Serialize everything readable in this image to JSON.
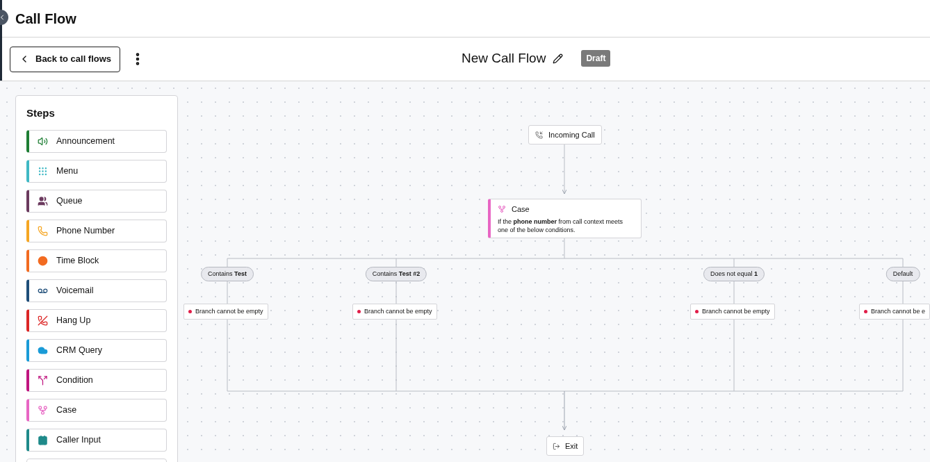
{
  "header": {
    "title": "Call Flow"
  },
  "toolbar": {
    "back_button": "Back to call flows",
    "flow_name": "New Call Flow",
    "status_badge": "Draft"
  },
  "steps_panel": {
    "title": "Steps",
    "steps": [
      {
        "label": "Announcement",
        "color": "#1e7e34"
      },
      {
        "label": "Menu",
        "color": "#3fb8c4"
      },
      {
        "label": "Queue",
        "color": "#6b3a5e"
      },
      {
        "label": "Phone Number",
        "color": "#f5a623"
      },
      {
        "label": "Time Block",
        "color": "#f26b21"
      },
      {
        "label": "Voicemail",
        "color": "#1f4e79"
      },
      {
        "label": "Hang Up",
        "color": "#dc2626"
      },
      {
        "label": "CRM Query",
        "color": "#1a9bd7"
      },
      {
        "label": "Condition",
        "color": "#c0157f"
      },
      {
        "label": "Case",
        "color": "#e866c4"
      },
      {
        "label": "Caller Input",
        "color": "#1f8a8a"
      }
    ]
  },
  "canvas": {
    "start_node": "Incoming Call",
    "case_node": {
      "title": "Case",
      "description": "If the **phone number** from call context meets one of the below conditions."
    },
    "branches": [
      {
        "label": "Contains **Test**",
        "error": "Branch cannot be empty"
      },
      {
        "label": "Contains **Test #2**",
        "error": "Branch cannot be empty"
      },
      {
        "label": "Does not equal **1**",
        "error": "Branch cannot be empty"
      },
      {
        "label": "Default",
        "error": "Branch cannot be e"
      }
    ],
    "exit_node": "Exit"
  }
}
